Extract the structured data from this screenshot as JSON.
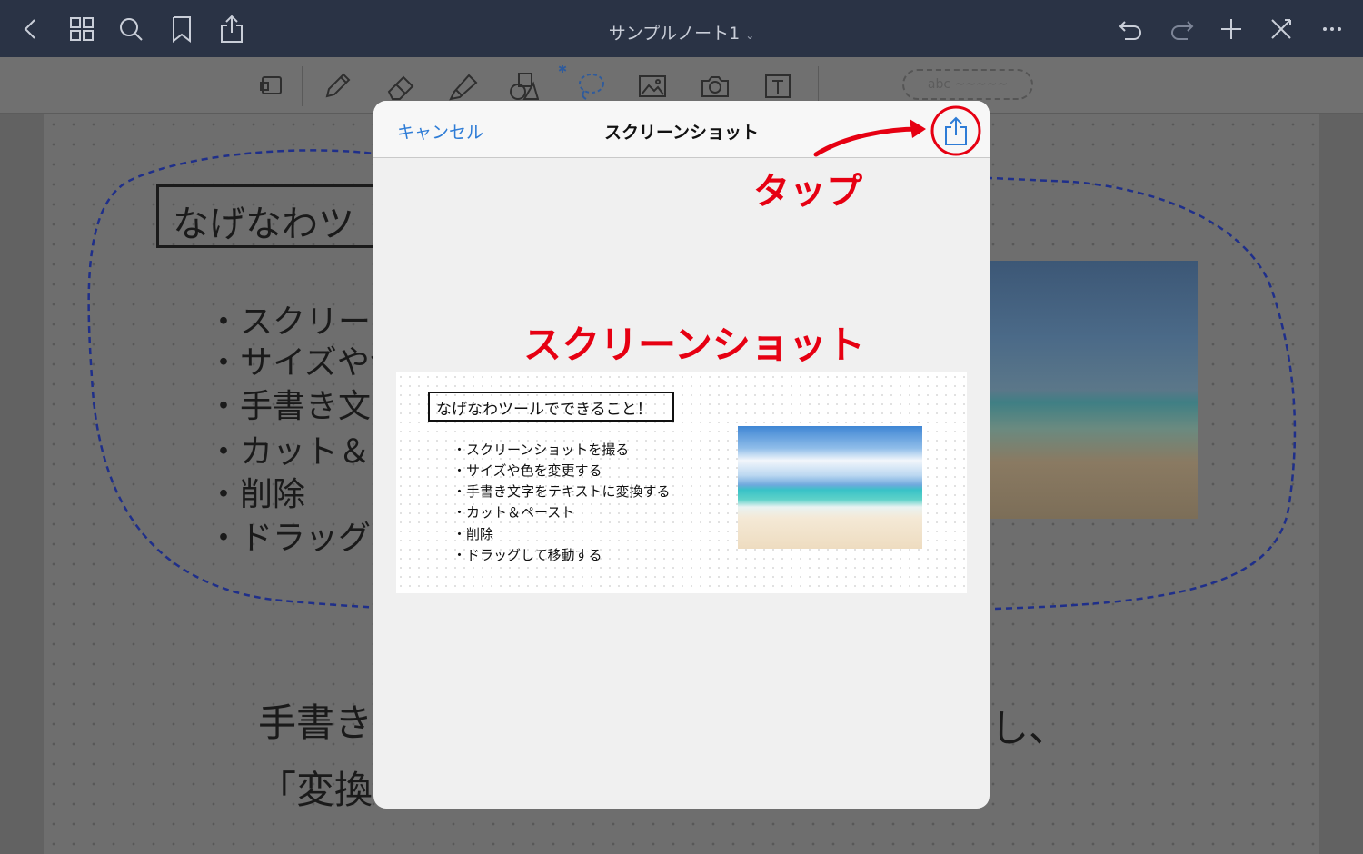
{
  "topbar": {
    "title": "サンプルノート1",
    "icons": [
      "back-icon",
      "grid-icon",
      "search-icon",
      "bookmark-icon",
      "share-icon",
      "undo-icon",
      "redo-icon",
      "add-icon",
      "close-icon",
      "more-icon"
    ]
  },
  "toolbar": {
    "tools": [
      "page-tool",
      "pen-tool",
      "eraser-tool",
      "highlighter-tool",
      "shapes-tool",
      "lasso-tool",
      "image-tool",
      "camera-tool",
      "text-tool"
    ],
    "bluetooth_glyph": "✱",
    "handwriting_placeholder": "abc ~~~~~"
  },
  "background_note": {
    "title": "なげなわツ",
    "items": [
      "・スクリーンシ",
      "・サイズや色",
      "・手書き文ウ",
      "・カット＆ペ",
      "・削除",
      "・ドラッグし"
    ],
    "line1": "手書き",
    "line1_right": "し、",
    "line2": "「変換"
  },
  "modal": {
    "cancel_label": "キャンセル",
    "title": "スクリーンショット",
    "share_icon": "share-icon"
  },
  "snapshot": {
    "title": "なげなわツールでできること！",
    "items": [
      "・スクリーンショットを撮る",
      "・サイズや色を変更する",
      "・手書き文字をテキストに変換する",
      "・カット＆ペースト",
      "・削除",
      "・ドラッグして移動する"
    ]
  },
  "annotations": {
    "tap_label": "タップ",
    "heading_label": "スクリーンショット",
    "color": "#e60012"
  },
  "colors": {
    "nav_bg": "#2a3345",
    "accent_blue": "#2e7cd6",
    "annotation_red": "#e60012"
  }
}
